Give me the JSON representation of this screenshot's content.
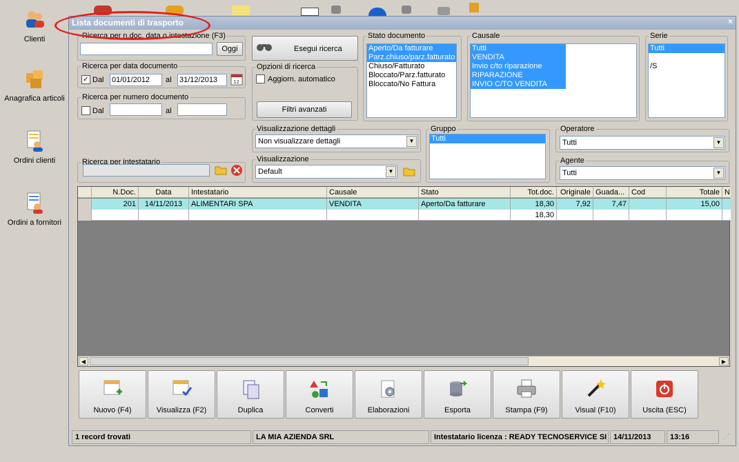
{
  "desktop": {
    "icons": [
      {
        "label": "Clienti"
      },
      {
        "label": "Anagrafica articoli"
      },
      {
        "label": "Ordini clienti"
      },
      {
        "label": "Ordini a fornitori"
      }
    ]
  },
  "window": {
    "title": "Lista documenti di trasporto",
    "close": "×"
  },
  "search_text": {
    "legend": "Ricerca per n.doc, data o intestazione (F3)",
    "value": "",
    "today_button": "Oggi"
  },
  "search_button": "Esegui ricerca",
  "date_search": {
    "legend": "Ricerca per data documento",
    "checked": true,
    "dal_label": "Dal",
    "from": "01/01/2012",
    "al_label": "al",
    "to": "31/12/2013"
  },
  "number_search": {
    "legend": "Ricerca per numero documento",
    "checked": false,
    "dal_label": "Dal",
    "from": "",
    "al_label": "al",
    "to": ""
  },
  "search_options": {
    "legend": "Opzioni di ricerca",
    "auto_update_label": "Aggiorn. automatico",
    "advanced_filters": "Filtri avanzati"
  },
  "holder_search": {
    "legend": "Ricerca per intestatario",
    "value": ""
  },
  "doc_status": {
    "legend": "Stato documento",
    "items": [
      {
        "label": "Aperto/Da fatturare",
        "selected": true
      },
      {
        "label": "Parz.chiuso/parz.fatturato",
        "selected": true
      },
      {
        "label": "Chiuso/Fatturato",
        "selected": false
      },
      {
        "label": "Bloccato/Parz.fatturato",
        "selected": false
      },
      {
        "label": "Bloccato/No Fattura",
        "selected": false
      }
    ]
  },
  "causale": {
    "legend": "Causale",
    "items": [
      {
        "label": "Tutti",
        "selected": true
      },
      {
        "label": "VENDITA",
        "selected": true
      },
      {
        "label": "Invio c/to riparazione",
        "selected": true
      },
      {
        "label": "RIPARAZIONE",
        "selected": true
      },
      {
        "label": "INVIO C/TO VENDITA",
        "selected": true
      }
    ]
  },
  "serie": {
    "legend": "Serie",
    "items": [
      {
        "label": "Tutti",
        "selected": true
      },
      {
        "label": "",
        "selected": false
      },
      {
        "label": "/S",
        "selected": false
      }
    ]
  },
  "detail_view": {
    "legend": "Visualizzazione dettagli",
    "value": "Non visualizzare dettagli"
  },
  "view": {
    "legend": "Visualizzazione",
    "value": "Default"
  },
  "gruppo": {
    "legend": "Gruppo",
    "items": [
      {
        "label": "Tutti",
        "selected": true
      }
    ]
  },
  "operatore": {
    "legend": "Operatore",
    "value": "Tutti"
  },
  "agente": {
    "legend": "Agente",
    "value": "Tutti"
  },
  "table": {
    "columns": [
      "",
      "N.Doc.",
      "Data",
      "Intestatario",
      "Causale",
      "Stato",
      "Tot.doc.",
      "Originale",
      "Guada...",
      "Cod",
      "Totale",
      "N"
    ],
    "rows": [
      [
        "",
        "201",
        "14/11/2013",
        "ALIMENTARI SPA",
        "VENDITA",
        "Aperto/Da fatturare",
        "18,30",
        "7,92",
        "7,47",
        "",
        "15,00",
        ""
      ]
    ],
    "totals": [
      "",
      "",
      "",
      "",
      "",
      "",
      "18,30",
      "",
      "",
      "",
      "",
      ""
    ]
  },
  "toolbar": [
    {
      "label": "Nuovo (F4)",
      "icon": "new-doc-icon"
    },
    {
      "label": "Visualizza (F2)",
      "icon": "view-doc-icon"
    },
    {
      "label": "Duplica",
      "icon": "duplicate-icon"
    },
    {
      "label": "Converti",
      "icon": "convert-icon"
    },
    {
      "label": "Elaborazioni",
      "icon": "process-icon"
    },
    {
      "label": "Esporta",
      "icon": "export-icon"
    },
    {
      "label": "Stampa (F9)",
      "icon": "printer-icon"
    },
    {
      "label": "Visual (F10)",
      "icon": "magic-wand-icon"
    },
    {
      "label": "Uscita (ESC)",
      "icon": "exit-icon"
    }
  ],
  "status": {
    "records": "1 record trovati",
    "company": "LA MIA AZIENDA SRL",
    "license": "Intestatario licenza : READY TECNOSERVICE SI",
    "date": "14/11/2013",
    "time": "13:16"
  },
  "colors": {
    "selection": "#3399ff",
    "row_highlight": "#a6e6e6",
    "highlight_circle": "#e02020"
  }
}
